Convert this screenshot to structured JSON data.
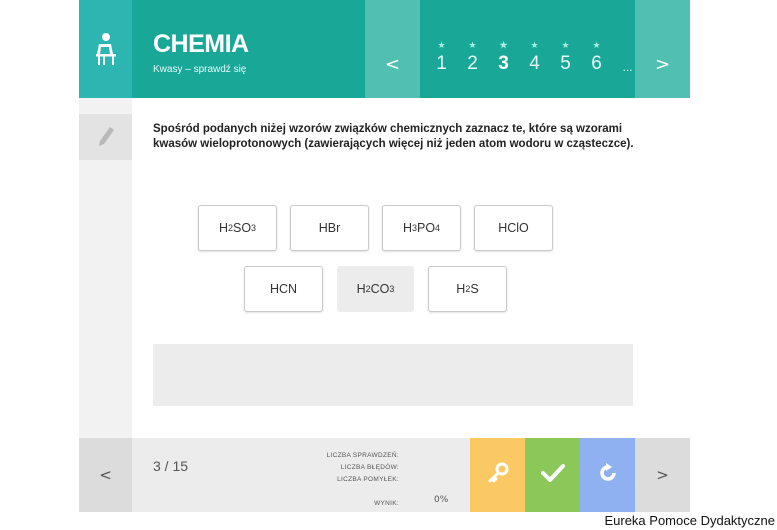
{
  "header": {
    "title": "CHEMIA",
    "subtitle": "Kwasy – sprawdź się",
    "nav_prev": "<",
    "nav_next": ">",
    "pages": [
      "1",
      "2",
      "3",
      "4",
      "5",
      "6",
      "..."
    ],
    "active_page": "3"
  },
  "question": {
    "text": "Spośród podanych niżej wzorów związków chemicznych zaznacz te, które są wzorami kwasów wieloprotonowych (zawierających więcej niż jeden atom wodoru w cząsteczce)."
  },
  "options": [
    {
      "label": "H2SO3",
      "selected": false
    },
    {
      "label": "HBr",
      "selected": false
    },
    {
      "label": "H3PO4",
      "selected": false
    },
    {
      "label": "HClO",
      "selected": false
    },
    {
      "label": "HCN",
      "selected": false
    },
    {
      "label": "H2CO3",
      "selected": true
    },
    {
      "label": "H2S",
      "selected": false
    }
  ],
  "footer": {
    "prev": "<",
    "next": ">",
    "counter": "3 / 15",
    "stats": {
      "checked_label": "LICZBA SPRAWDZEŃ:",
      "errors_label": "LICZBA BŁĘDÓW:",
      "mistakes_label": "LICZBA POMYŁEK:",
      "result_label": "WYNIK:"
    },
    "score": "0%",
    "icons": {
      "hint": "key-icon",
      "check": "checkmark-icon",
      "reset": "refresh-icon"
    },
    "colors": {
      "hint": "#fbc964",
      "check": "#8cc75a",
      "reset": "#8fb1f2"
    }
  },
  "credit": "Eureka Pomoce Dydaktyczne",
  "colors": {
    "header": "#19a898",
    "accent": "#2cb5b1"
  }
}
